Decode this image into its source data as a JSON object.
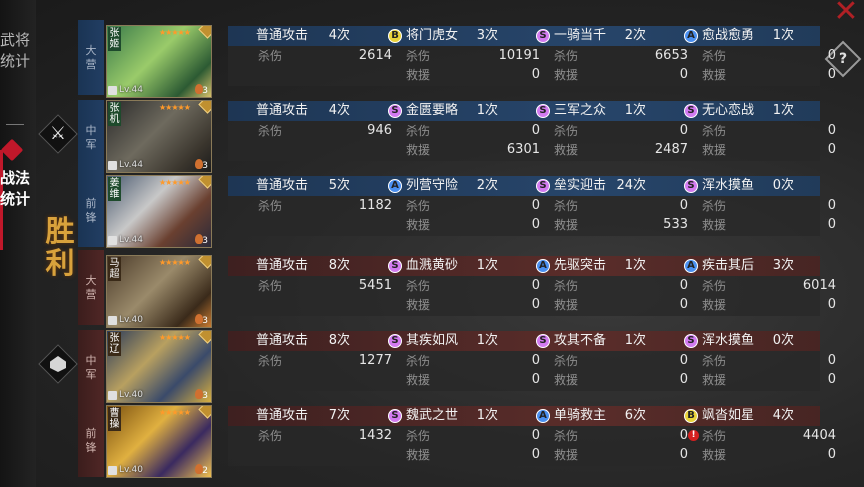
{
  "nav": {
    "tabs": [
      {
        "label": "武将统计",
        "active": false
      },
      {
        "label": "战法统计",
        "active": true
      }
    ]
  },
  "result_label": "胜利",
  "buttons": {
    "close_icon": "close-icon",
    "help": "?"
  },
  "colors": {
    "ally": "#27456a",
    "enemy": "#5a2d2a",
    "accent_red": "#c0182a",
    "victory_gold": "#d9a23c",
    "S": "#d27af0",
    "A": "#4a8ff0",
    "B": "#e9d23a"
  },
  "rows": [
    {
      "side": "ally",
      "position": "大营",
      "name": "张姬",
      "level": "Lv.44",
      "stars": "★★★★★",
      "count": "3",
      "skills": [
        {
          "grade": "",
          "name": "普通攻击",
          "count": "4次",
          "stats": [
            {
              "label": "杀伤",
              "value": "2614"
            }
          ]
        },
        {
          "grade": "B",
          "name": "将门虎女",
          "count": "3次",
          "stats": [
            {
              "label": "杀伤",
              "value": "10191"
            },
            {
              "label": "救援",
              "value": "0"
            }
          ]
        },
        {
          "grade": "S",
          "name": "一骑当千",
          "count": "2次",
          "stats": [
            {
              "label": "杀伤",
              "value": "6653"
            },
            {
              "label": "救援",
              "value": "0"
            }
          ]
        },
        {
          "grade": "A",
          "name": "愈战愈勇",
          "count": "1次",
          "stats": [
            {
              "label": "杀伤",
              "value": "0"
            },
            {
              "label": "救援",
              "value": "0"
            }
          ]
        }
      ]
    },
    {
      "side": "ally",
      "position": "中军",
      "name": "张机",
      "level": "Lv.44",
      "stars": "★★★★★",
      "count": "3",
      "skills": [
        {
          "grade": "",
          "name": "普通攻击",
          "count": "4次",
          "stats": [
            {
              "label": "杀伤",
              "value": "946"
            }
          ]
        },
        {
          "grade": "S",
          "name": "金匮要略",
          "count": "1次",
          "stats": [
            {
              "label": "杀伤",
              "value": "0"
            },
            {
              "label": "救援",
              "value": "6301"
            }
          ]
        },
        {
          "grade": "S",
          "name": "三军之众",
          "count": "1次",
          "stats": [
            {
              "label": "杀伤",
              "value": "0"
            },
            {
              "label": "救援",
              "value": "2487"
            }
          ]
        },
        {
          "grade": "S",
          "name": "无心恋战",
          "count": "1次",
          "stats": [
            {
              "label": "杀伤",
              "value": "0"
            },
            {
              "label": "救援",
              "value": "0"
            }
          ]
        }
      ]
    },
    {
      "side": "ally",
      "position": "前锋",
      "name": "姜维",
      "level": "Lv.44",
      "stars": "★★★★★",
      "count": "3",
      "skills": [
        {
          "grade": "",
          "name": "普通攻击",
          "count": "5次",
          "stats": [
            {
              "label": "杀伤",
              "value": "1182"
            }
          ]
        },
        {
          "grade": "A",
          "name": "列营守险",
          "count": "2次",
          "stats": [
            {
              "label": "杀伤",
              "value": "0"
            },
            {
              "label": "救援",
              "value": "0"
            }
          ]
        },
        {
          "grade": "S",
          "name": "垒实迎击",
          "count": "24次",
          "stats": [
            {
              "label": "杀伤",
              "value": "0"
            },
            {
              "label": "救援",
              "value": "533"
            }
          ]
        },
        {
          "grade": "S",
          "name": "浑水摸鱼",
          "count": "0次",
          "stats": [
            {
              "label": "杀伤",
              "value": "0"
            },
            {
              "label": "救援",
              "value": "0"
            }
          ]
        }
      ]
    },
    {
      "side": "enemy",
      "position": "大营",
      "name": "马超",
      "level": "Lv.40",
      "stars": "★★★★★",
      "count": "3",
      "skills": [
        {
          "grade": "",
          "name": "普通攻击",
          "count": "8次",
          "stats": [
            {
              "label": "杀伤",
              "value": "5451"
            }
          ]
        },
        {
          "grade": "S",
          "name": "血溅黄砂",
          "count": "1次",
          "stats": [
            {
              "label": "杀伤",
              "value": "0"
            },
            {
              "label": "救援",
              "value": "0"
            }
          ]
        },
        {
          "grade": "A",
          "name": "先驱突击",
          "count": "1次",
          "stats": [
            {
              "label": "杀伤",
              "value": "0"
            },
            {
              "label": "救援",
              "value": "0"
            }
          ]
        },
        {
          "grade": "A",
          "name": "疾击其后",
          "count": "3次",
          "stats": [
            {
              "label": "杀伤",
              "value": "6014"
            },
            {
              "label": "救援",
              "value": "0"
            }
          ]
        }
      ]
    },
    {
      "side": "enemy",
      "position": "中军",
      "name": "张辽",
      "level": "Lv.40",
      "stars": "★★★★★",
      "count": "3",
      "skills": [
        {
          "grade": "",
          "name": "普通攻击",
          "count": "8次",
          "stats": [
            {
              "label": "杀伤",
              "value": "1277"
            }
          ]
        },
        {
          "grade": "S",
          "name": "其疾如风",
          "count": "1次",
          "stats": [
            {
              "label": "杀伤",
              "value": "0"
            },
            {
              "label": "救援",
              "value": "0"
            }
          ]
        },
        {
          "grade": "S",
          "name": "攻其不备",
          "count": "1次",
          "stats": [
            {
              "label": "杀伤",
              "value": "0"
            },
            {
              "label": "救援",
              "value": "0"
            }
          ]
        },
        {
          "grade": "S",
          "name": "浑水摸鱼",
          "count": "0次",
          "stats": [
            {
              "label": "杀伤",
              "value": "0"
            },
            {
              "label": "救援",
              "value": "0"
            }
          ]
        }
      ]
    },
    {
      "side": "enemy",
      "position": "前锋",
      "name": "曹操",
      "level": "Lv.40",
      "stars": "★★★★★",
      "count": "2",
      "skills": [
        {
          "grade": "",
          "name": "普通攻击",
          "count": "7次",
          "stats": [
            {
              "label": "杀伤",
              "value": "1432"
            }
          ]
        },
        {
          "grade": "S",
          "name": "魏武之世",
          "count": "1次",
          "stats": [
            {
              "label": "杀伤",
              "value": "0"
            },
            {
              "label": "救援",
              "value": "0"
            }
          ]
        },
        {
          "grade": "A",
          "name": "单骑救主",
          "count": "6次",
          "stats": [
            {
              "label": "杀伤",
              "value": "0"
            },
            {
              "label": "救援",
              "value": "0"
            }
          ]
        },
        {
          "grade": "B",
          "name": "飒沓如星",
          "count": "4次",
          "warn": true,
          "stats": [
            {
              "label": "杀伤",
              "value": "4404"
            },
            {
              "label": "救援",
              "value": "0"
            }
          ]
        }
      ]
    }
  ]
}
